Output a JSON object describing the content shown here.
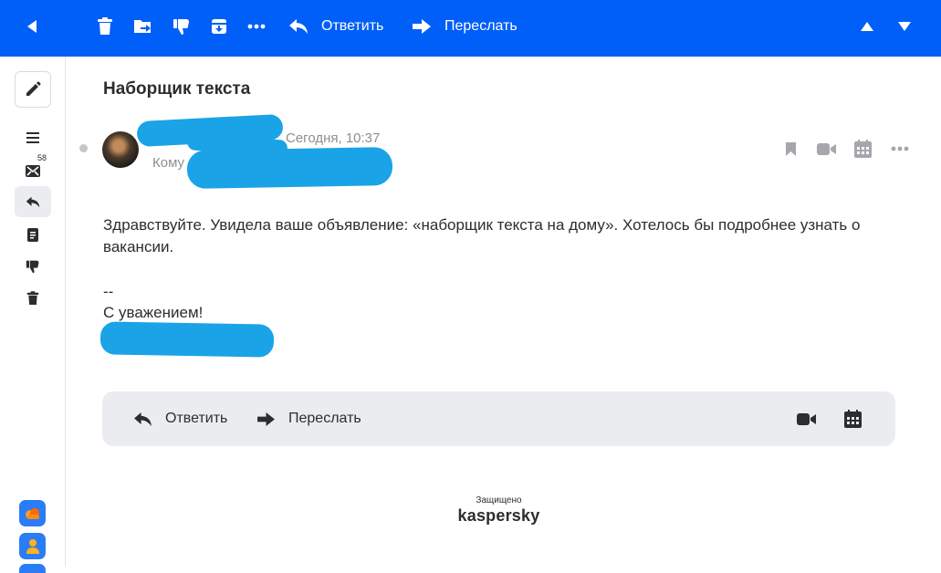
{
  "toolbar": {
    "reply_label": "Ответить",
    "forward_label": "Переслать"
  },
  "sidebar": {
    "unread_count": "58"
  },
  "message": {
    "subject": "Наборщик текста",
    "date": "Сегодня, 10:37",
    "to_label": "Кому",
    "body": "Здравствуйте. Увидела ваше объявление: «наборщик текста на дому». Хотелось бы подробнее узнать о вакансии.",
    "signature_dash": "--",
    "signature": "С уважением!"
  },
  "reply_panel": {
    "reply_label": "Ответить",
    "forward_label": "Переслать"
  },
  "footer": {
    "protected_label": "Защищено",
    "brand": "kaspersky"
  },
  "colors": {
    "topbar": "#005ff9",
    "redaction": "#1aa3e6",
    "panel": "#ebecef"
  }
}
